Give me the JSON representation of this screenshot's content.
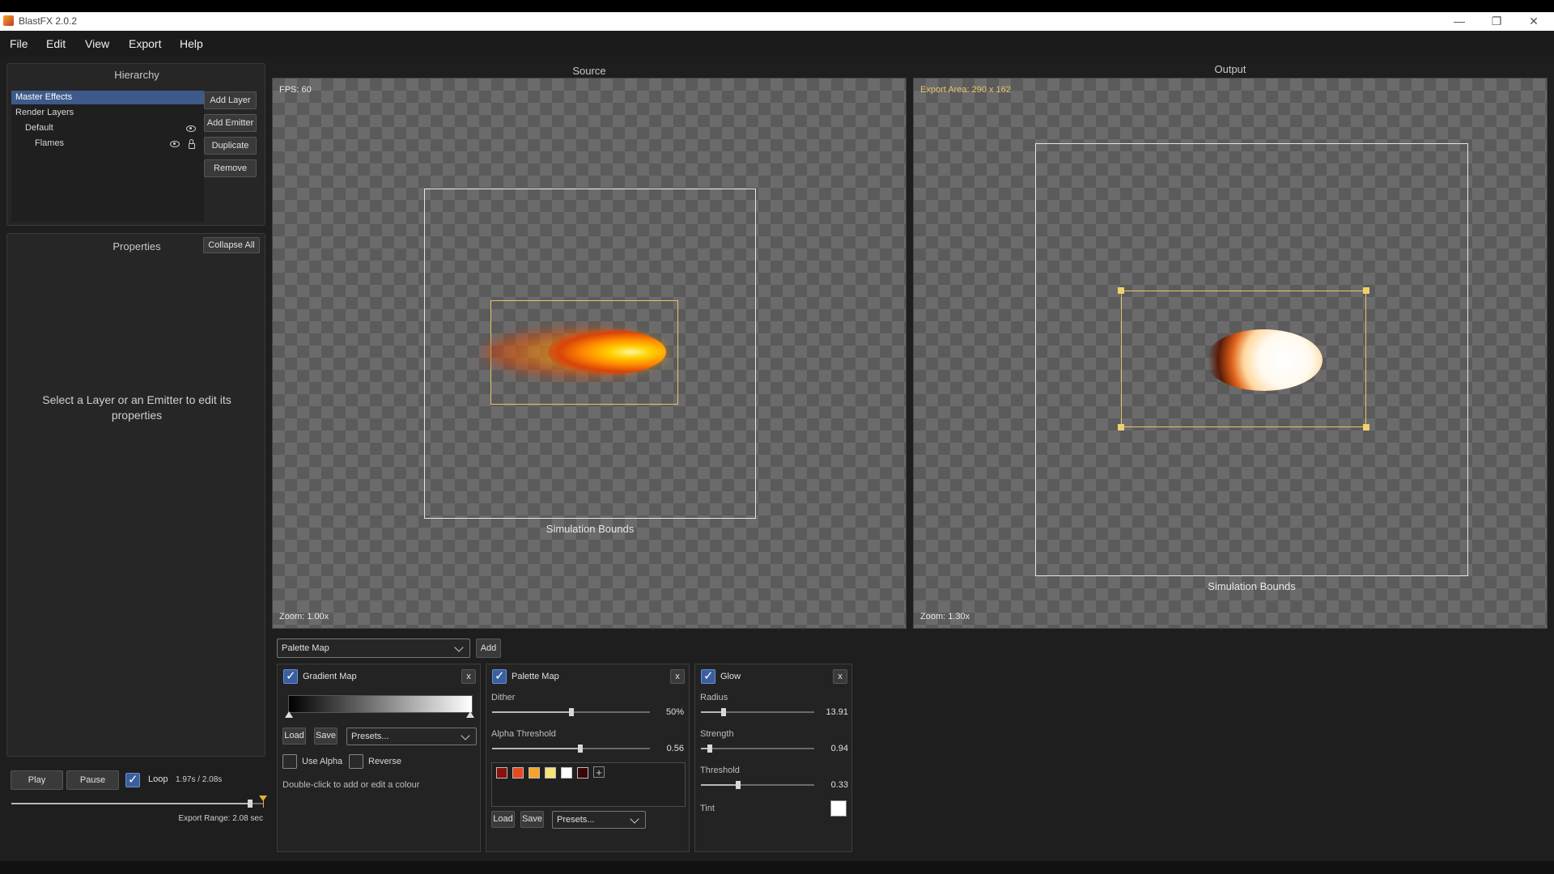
{
  "window": {
    "title": "BlastFX 2.0.2",
    "controls": [
      "—",
      "❐",
      "✕"
    ]
  },
  "menu": [
    "File",
    "Edit",
    "View",
    "Export",
    "Help"
  ],
  "hierarchy": {
    "title": "Hierarchy",
    "items": [
      {
        "label": "Master Effects"
      },
      {
        "label": "Render Layers"
      },
      {
        "label": "Default"
      },
      {
        "label": "Flames"
      }
    ],
    "buttons": {
      "add_layer": "Add Layer",
      "add_emitter": "Add Emitter",
      "duplicate": "Duplicate",
      "remove": "Remove"
    }
  },
  "properties": {
    "title": "Properties",
    "collapse_all": "Collapse All",
    "empty_message": "Select a Layer or an Emitter to edit its properties"
  },
  "playback": {
    "play": "Play",
    "pause": "Pause",
    "loop_label": "Loop",
    "loop_checked": true,
    "time": "1.97s / 2.08s",
    "progress": 0.947,
    "export_range": "Export Range: 2.08 sec"
  },
  "source": {
    "title": "Source",
    "fps": "FPS: 60",
    "zoom": "Zoom: 1.00x",
    "bounds_label": "Simulation Bounds"
  },
  "output": {
    "title": "Output",
    "export_area": "Export Area: 290 x 162",
    "zoom": "Zoom: 1.30x",
    "bounds_label": "Simulation Bounds"
  },
  "effects_bar": {
    "selected": "Palette Map",
    "add": "Add"
  },
  "gradient_map": {
    "title": "Gradient Map",
    "enabled": true,
    "close": "x",
    "load": "Load",
    "save": "Save",
    "presets": "Presets...",
    "use_alpha": "Use Alpha",
    "reverse": "Reverse",
    "hint": "Double-click to add or edit a colour"
  },
  "palette_map": {
    "title": "Palette Map",
    "enabled": true,
    "close": "x",
    "dither_label": "Dither",
    "dither_value": "50%",
    "dither_level": 0.5,
    "alpha_label": "Alpha Threshold",
    "alpha_value": "0.56",
    "alpha_level": 0.56,
    "swatches": [
      "#8b1010",
      "#e8481e",
      "#f6a32b",
      "#f7e27a",
      "#ffffff",
      "#3a0608"
    ],
    "add_swatch": "+",
    "load": "Load",
    "save": "Save",
    "presets": "Presets..."
  },
  "glow": {
    "title": "Glow",
    "enabled": true,
    "close": "x",
    "radius_label": "Radius",
    "radius_value": "13.91",
    "radius_level": 0.2,
    "strength_label": "Strength",
    "strength_value": "0.94",
    "strength_level": 0.08,
    "threshold_label": "Threshold",
    "threshold_value": "0.33",
    "threshold_level": 0.33,
    "tint_label": "Tint",
    "tint_color": "#ffffff"
  },
  "icons": {
    "app": "blastfx-logo-icon",
    "visibility": "eye-icon",
    "lock": "lock-icon",
    "dropdown": "chevron-down-icon",
    "loop_marker": "export-end-marker-icon"
  }
}
